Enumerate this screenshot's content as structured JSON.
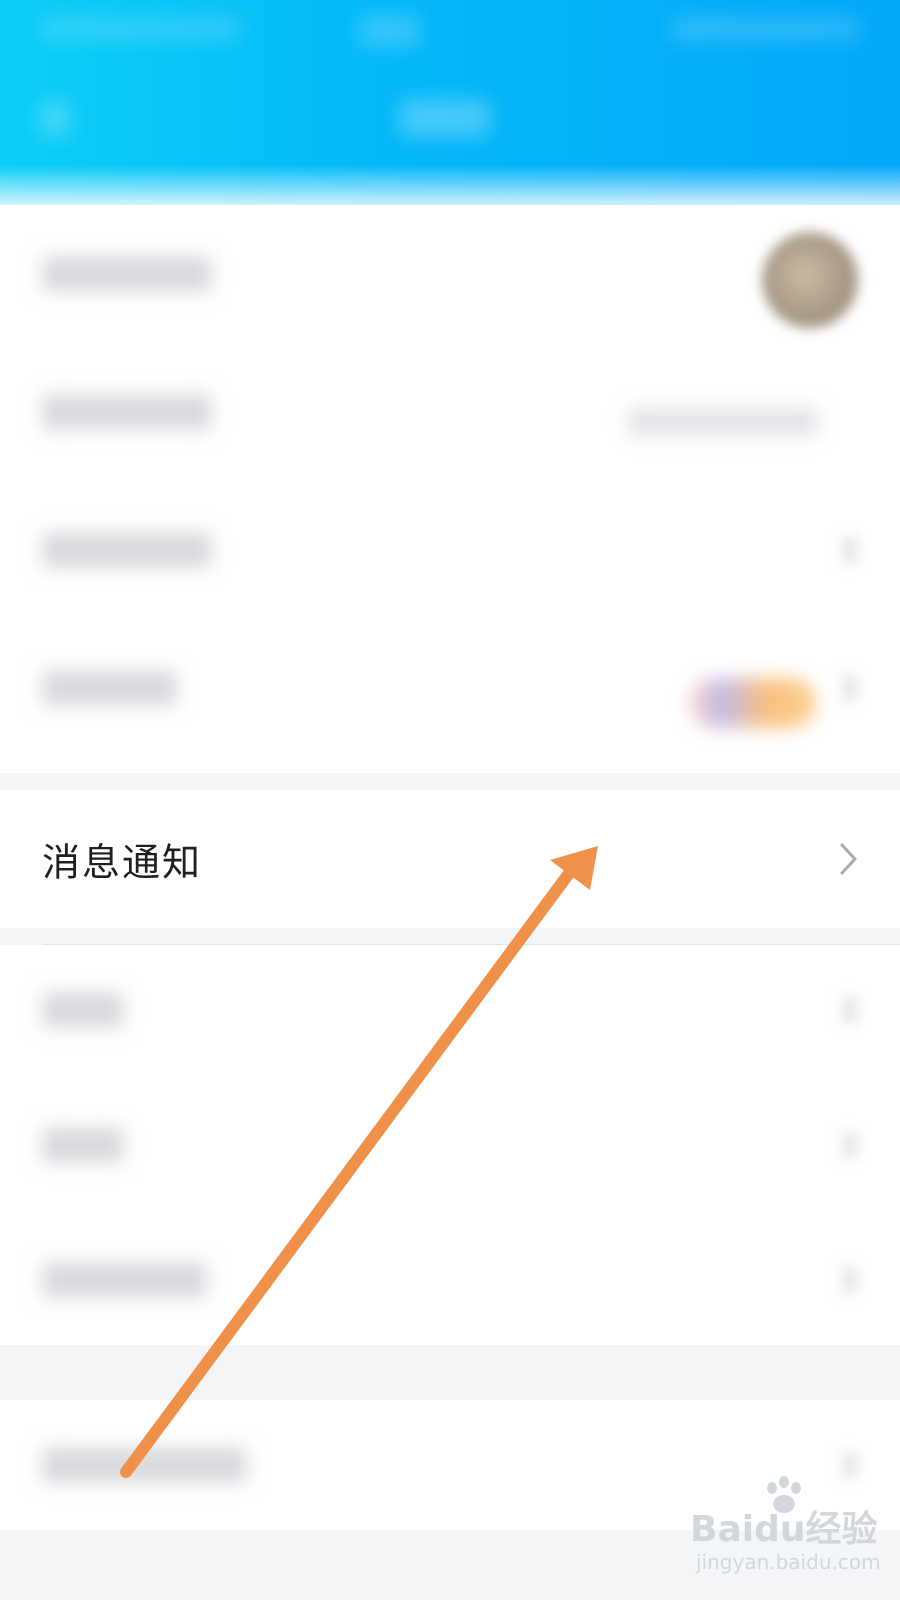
{
  "header": {
    "background_start": "#0bcef6",
    "background_end": "#03a8f9"
  },
  "settings": {
    "focused_item": {
      "label": "消息通知",
      "chevron_icon": "chevron-right-icon"
    }
  },
  "annotation": {
    "arrow_color": "#f0914a"
  },
  "watermark": {
    "brand": "Baidu经验",
    "url": "jingyan.baidu.com"
  }
}
